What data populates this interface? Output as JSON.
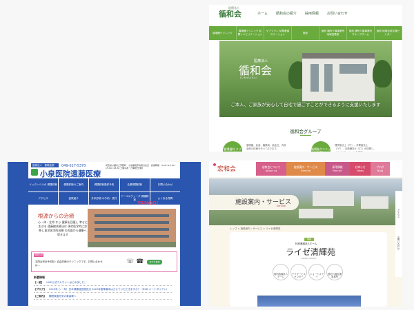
{
  "panel_a": {
    "logo_sub": "医療法人",
    "logo": "循和会",
    "nav": [
      "ホーム",
      "循和会の紹介",
      "採用情報",
      "お問い合わせ"
    ],
    "green_bar": [
      "循環器クリニック",
      "循環器クリニック 訪問リハビリテーション",
      "ケアプラン 訪問看護ステーション",
      "施設",
      "施設 通所介護事業所 地域密着型",
      "施設 通所介護事業所 グループホーム",
      "施設 地域包括支援センター"
    ],
    "hero_small": "医療法人",
    "hero_title": "循和会",
    "hero_roman": "JUNWAKAI",
    "hero_message": "ご本人、ご家族が安心して自宅で過ごすことができるように支援いたします",
    "group_title": "循和会グループ",
    "blob1": "循環器科 クリニック",
    "blob2": "循環器クリニック 訪問リハ",
    "text1": "循環器、血液、糖尿病、高血圧、内科全般の診療を行っております。",
    "text2": "理学療法士（PT）、作業療法士（OT）、言語聴覚士（ST）が訪問し、リハビリテーションを実施。"
  },
  "panel_b": {
    "name_badge": "医療法人　都筑医院",
    "tel": "049-027-5370",
    "brand": "小泉医院遠藤医療",
    "address": "埼玉県川越市三芳野町　小泉医院予約受付窓口　診療時間　9:00〜12:30 / 15:00〜18:30 土曜午後・日曜祝日休診",
    "nav": [
      "ドックレベルの 健康診断",
      "健康診断のご案内",
      "健康診断受診予約",
      "企業健康診断",
      "お問い合わせ",
      "アクセス",
      "医院紹介",
      "外来診療 の予約・受付",
      "アーユルヴェーダ 健康教室",
      "よくある質問"
    ],
    "search_text": "サイトマップ　よくある質問　その他の方はこちら",
    "yahoo": "YAHOO!",
    "hero_title": "根源からの治癒",
    "hero_text": "心・体・生命 から 健康を回復し 幸せに生きる 遠藤総合療法は 現代医学的に診断し東洋医学的治療 の両面から健康へ導きます",
    "notice_badge": "お知らせ",
    "notice_text": "当院は完全予約制・自由診療のクリニックです。お問い合わせは…",
    "line_button": "友だち追加",
    "news_header": "新着情報",
    "news": [
      {
        "tag": "【一般】",
        "text": "LINE公式アカウントはじめました！"
      },
      {
        "tag": "【ブログ】",
        "text": "2025年 () 一年）日本健康経営優良法 2025年度準備中はさせていただきますか？（RGB オーナダイアン）"
      },
      {
        "tag": "【ご案内】",
        "text": "睡眠検査外来の患者様へ"
      }
    ]
  },
  "panel_c": {
    "logo": "宏和会",
    "tabs": [
      {
        "label": "宏和会について",
        "sub": "About us",
        "color": "#d6608a"
      },
      {
        "label": "施設案内・サービス",
        "sub": "Service",
        "color": "#e08a4a"
      },
      {
        "label": "採用情報",
        "sub": "Recruit",
        "color": "#c85a8a"
      },
      {
        "label": "お知らせ",
        "sub": "News",
        "color": "#d64a6a"
      },
      {
        "label": "ブログ",
        "sub": "Blog",
        "color": "#e07a9a"
      }
    ],
    "page_title": "施設案内・サービス",
    "page_sub": "Service",
    "breadcrumb": "トップ > 施設案内・サービス > ライゼ清輝苑",
    "badge": "施設",
    "subtitle": "特別養護老人ホーム",
    "facility_name": "ライゼ清輝苑",
    "facility_roman": "REIZE SEIKIEN",
    "features": [
      "特別養護老人ホーム",
      "デイサービスセンター",
      "ショートステイ",
      "居宅介護支援事業所"
    ],
    "side_links": [
      "アクセス",
      "お問い合わせ"
    ]
  }
}
